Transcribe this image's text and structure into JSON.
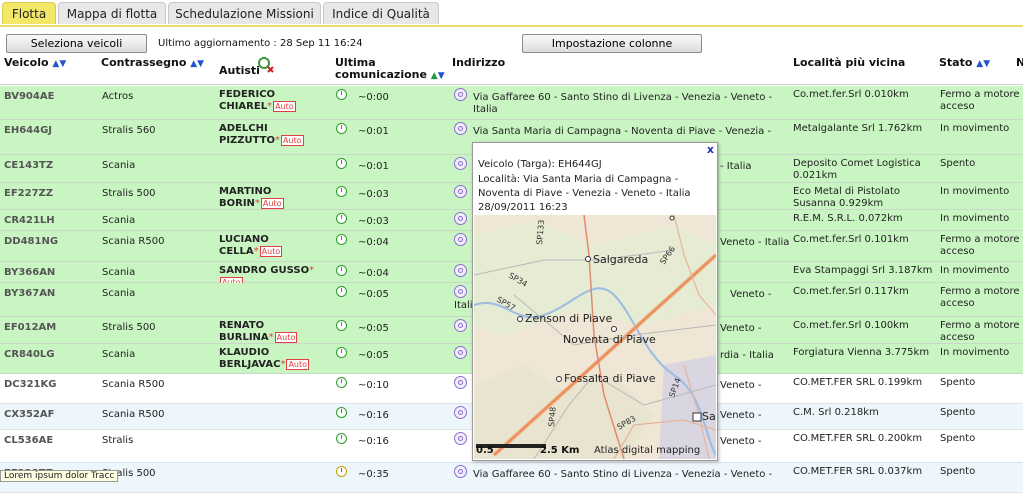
{
  "tabs": [
    "Flotta",
    "Mappa di flotta",
    "Schedulazione Missioni",
    "Indice di Qualità"
  ],
  "toolbar": {
    "select_button": "Seleziona veicoli",
    "last_update": "Ultimo aggiornamento : 28 Sep 11 16:24",
    "columns_button": "Impostazione colonne"
  },
  "headers": {
    "vehicle": "Veicolo",
    "tag": "Contrassegno",
    "drivers": "Autisti",
    "last_comm_1": "Ultima",
    "last_comm_2": "comunicazione",
    "address": "Indirizzo",
    "nearest": "Località più vicina",
    "status": "Stato",
    "extra": "N"
  },
  "auto_label": "Auto",
  "rows": [
    {
      "plate": "BV904AE",
      "tag": "Actros",
      "drv1": "FEDERICO",
      "drv2": "CHIAREL",
      "time": "~0:00",
      "addr1": "Via Gaffaree 60 - Santo Stino di Livenza - Venezia - Veneto -",
      "addr2": "Italia",
      "near1": "Co.met.fer.Srl 0.010km",
      "near2": "",
      "stat1": "Fermo a motore",
      "stat2": "acceso"
    },
    {
      "plate": "EH644GJ",
      "tag": "Stralis 560",
      "drv1": "ADELCHI",
      "drv2": "PIZZUTTO",
      "time": "~0:01",
      "addr1": "Via Santa Maria di Campagna - Noventa di Piave - Venezia -",
      "addr2": "",
      "near1": "Metalgalante Srl 1.762km",
      "near2": "",
      "stat1": "In movimento",
      "stat2": ""
    },
    {
      "plate": "CE143TZ",
      "tag": "Scania",
      "drv1": "",
      "drv2": "",
      "time": "~0:01",
      "addr1": "- Italia",
      "addr2": "",
      "near1": "Deposito Comet Logistica",
      "near2": "0.021km",
      "stat1": "Spento",
      "stat2": ""
    },
    {
      "plate": "EF227ZZ",
      "tag": "Stralis 500",
      "drv1": "MARTINO",
      "drv2": "BORIN",
      "time": "~0:03",
      "addr1": "",
      "addr2": "",
      "near1": "Eco Metal di Pistolato",
      "near2": "Susanna 0.929km",
      "stat1": "In movimento",
      "stat2": ""
    },
    {
      "plate": "CR421LH",
      "tag": "Scania",
      "drv1": "",
      "drv2": "",
      "time": "~0:03",
      "addr1": "",
      "addr2": "",
      "near1": "R.E.M. S.R.L. 0.072km",
      "near2": "",
      "stat1": "In movimento",
      "stat2": ""
    },
    {
      "plate": "DD481NG",
      "tag": "Scania R500",
      "drv1": "LUCIANO",
      "drv2": "CELLA",
      "time": "~0:04",
      "addr1": "Veneto - Italia",
      "addr2": "",
      "near1": "Co.met.fer.Srl 0.101km",
      "near2": "",
      "stat1": "Fermo a motore",
      "stat2": "acceso"
    },
    {
      "plate": "BY366AN",
      "tag": "Scania",
      "drv1": "SANDRO GUSSO",
      "drv2": "",
      "time": "~0:04",
      "addr1": "",
      "addr2": "",
      "near1": "Eva Stampaggi Srl 3.187km",
      "near2": "",
      "stat1": "In movimento",
      "stat2": ""
    },
    {
      "plate": "BY367AN",
      "tag": "Scania",
      "drv1": "",
      "drv2": "",
      "time": "~0:05",
      "addr1": "Veneto -",
      "addr2": "Itali",
      "near1": "Co.met.fer.Srl 0.117km",
      "near2": "",
      "stat1": "Fermo a motore",
      "stat2": "acceso"
    },
    {
      "plate": "EF012AM",
      "tag": "Stralis 500",
      "drv1": "RENATO",
      "drv2": "BURLINA",
      "time": "~0:05",
      "addr1": "Veneto -",
      "addr2": "",
      "near1": "Co.met.fer.Srl 0.100km",
      "near2": "",
      "stat1": "Fermo a motore",
      "stat2": "acceso"
    },
    {
      "plate": "CR840LG",
      "tag": "Scania",
      "drv1": "KLAUDIO",
      "drv2": "BERLJAVAC",
      "time": "~0:05",
      "addr1": "rdia - Italia",
      "addr2": "",
      "near1": "Forgiatura Vienna 3.775km",
      "near2": "",
      "stat1": "In movimento",
      "stat2": ""
    },
    {
      "plate": "DC321KG",
      "tag": "Scania R500",
      "drv1": "",
      "drv2": "",
      "time": "~0:10",
      "addr1": "Veneto -",
      "addr2": "",
      "near1": "CO.MET.FER SRL 0.199km",
      "near2": "",
      "stat1": "Spento",
      "stat2": ""
    },
    {
      "plate": "CX352AF",
      "tag": "Scania R500",
      "drv1": "",
      "drv2": "",
      "time": "~0:16",
      "addr1": "Veneto -",
      "addr2": "",
      "near1": "C.M. Srl 0.218km",
      "near2": "",
      "stat1": "Spento",
      "stat2": ""
    },
    {
      "plate": "CL536AE",
      "tag": "Stralis",
      "drv1": "",
      "drv2": "",
      "time": "~0:16",
      "addr1": "Veneto -",
      "addr2": "",
      "near1": "CO.MET.FER SRL 0.200km",
      "near2": "",
      "stat1": "Spento",
      "stat2": ""
    },
    {
      "plate": "EF228ZZ",
      "tag": "Stralis 500",
      "drv1": "",
      "drv2": "",
      "time": "~0:35",
      "addr1": "Via Gaffaree 60 - Santo Stino di Livenza - Venezia - Veneto -",
      "addr2": "",
      "near1": "CO.MET.FER SRL 0.037km",
      "near2": "",
      "stat1": "Spento",
      "stat2": ""
    }
  ],
  "popup": {
    "close": "x",
    "line1": "Veicolo (Targa): EH644GJ",
    "line2": "Località: Via Santa Maria di Campagna -",
    "line3": "Noventa di Piave - Venezia - Veneto - Italia",
    "line4": "28/09/2011 16:23",
    "map_labels": {
      "salgareda": "Salgareda",
      "zenson": "Zenson di Piave",
      "noventa": "Noventa di Piave",
      "fossalta": "Fossalta di Piave",
      "san": "San",
      "sp133": "SP133",
      "sp34": "SP34",
      "sp57": "SP57",
      "sp66": "SP66",
      "sp48": "SP48",
      "sp83": "SP83",
      "sp14": "SP14",
      "scale": "0.5",
      "scale_unit": "2.5 Km",
      "attribution": "Atlas digital mapping"
    }
  },
  "status_tip": "Lorem ipsum dolor Tracc"
}
